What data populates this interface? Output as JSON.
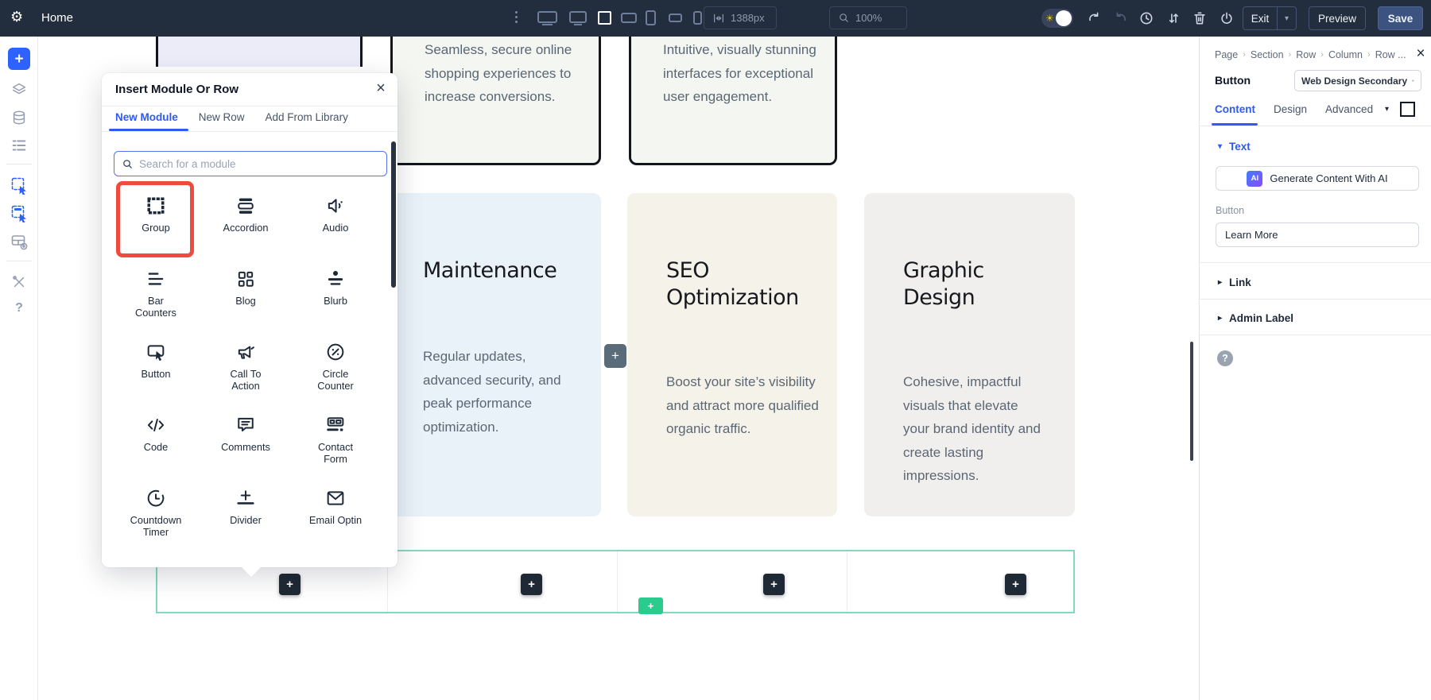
{
  "toolbar": {
    "page_title": "Home",
    "width_value": "1388px",
    "zoom_value": "100%",
    "exit_label": "Exit",
    "preview_label": "Preview",
    "save_label": "Save"
  },
  "modal": {
    "title": "Insert Module Or Row",
    "tabs": [
      {
        "label": "New Module",
        "active": true
      },
      {
        "label": "New Row",
        "active": false
      },
      {
        "label": "Add From Library",
        "active": false
      }
    ],
    "search_placeholder": "Search for a module",
    "modules": [
      {
        "label": "Group",
        "icon": "group-icon",
        "highlighted": true
      },
      {
        "label": "Accordion",
        "icon": "accordion-icon"
      },
      {
        "label": "Audio",
        "icon": "audio-icon"
      },
      {
        "label": "Bar Counters",
        "icon": "bar-counters-icon"
      },
      {
        "label": "Blog",
        "icon": "blog-icon"
      },
      {
        "label": "Blurb",
        "icon": "blurb-icon"
      },
      {
        "label": "Button",
        "icon": "button-icon"
      },
      {
        "label": "Call To Action",
        "icon": "call-to-action-icon"
      },
      {
        "label": "Circle Counter",
        "icon": "circle-counter-icon"
      },
      {
        "label": "Code",
        "icon": "code-icon"
      },
      {
        "label": "Comments",
        "icon": "comments-icon"
      },
      {
        "label": "Contact Form",
        "icon": "contact-form-icon"
      },
      {
        "label": "Countdown Timer",
        "icon": "countdown-timer-icon"
      },
      {
        "label": "Divider",
        "icon": "divider-icon"
      },
      {
        "label": "Email Optin",
        "icon": "email-optin-icon"
      }
    ],
    "highlight_color": "#ee4b3e"
  },
  "canvas": {
    "top_cards": [
      {
        "text": "Seamless, secure online shopping experiences to increase conversions."
      },
      {
        "text": "Intuitive, visually stunning interfaces for exceptional user engagement."
      }
    ],
    "cards": [
      {
        "title": "Maintenance",
        "body": "Regular updates, advanced security, and peak performance optimization.",
        "bg": "#e9f2f9"
      },
      {
        "title": "SEO Optimization",
        "body": "Boost your site’s visibility and attract more qualified organic traffic.",
        "bg": "#f5f2ea"
      },
      {
        "title": "Graphic Design",
        "body": "Cohesive, impactful visuals that elevate your brand identity and create lasting impressions.",
        "bg": "#f0efed"
      }
    ],
    "insert_plus": "+",
    "row_accent_color": "#82d9c0",
    "green_plus_color": "#2bcb8e"
  },
  "panel": {
    "breadcrumb": [
      "Page",
      "Section",
      "Row",
      "Column",
      "Row ..."
    ],
    "element_type": "Button",
    "preset_value": "Web Design Secondary",
    "tabs": [
      {
        "label": "Content",
        "active": true
      },
      {
        "label": "Design",
        "active": false
      },
      {
        "label": "Advanced",
        "active": false
      }
    ],
    "text_section_title": "Text",
    "ai_button_label": "Generate Content With AI",
    "ai_badge": "AI",
    "button_field_label": "Button",
    "button_field_value": "Learn More",
    "link_section_title": "Link",
    "admin_section_title": "Admin Label",
    "accent_color": "#2f5af5"
  }
}
